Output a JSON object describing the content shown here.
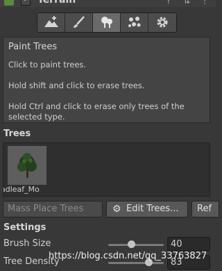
{
  "header": {
    "title": "Terrain"
  },
  "toolbar": {
    "tools": [
      {
        "name": "raise-lower-terrain",
        "active": false
      },
      {
        "name": "paint-texture",
        "active": false
      },
      {
        "name": "paint-trees",
        "active": true
      },
      {
        "name": "paint-details",
        "active": false
      },
      {
        "name": "terrain-settings",
        "active": false
      }
    ]
  },
  "help": {
    "title": "Paint Trees",
    "line1": "Click to paint trees.",
    "line2": "Hold shift and click to erase trees.",
    "line3": "Hold Ctrl and click to erase only trees of the",
    "line4": "selected type."
  },
  "trees": {
    "title": "Trees",
    "items": [
      {
        "label": "adleaf_Mo"
      }
    ]
  },
  "actions": {
    "mass_place": "Mass Place Trees",
    "edit_trees": "Edit Trees...",
    "refresh": "Ref"
  },
  "settings": {
    "title": "Settings",
    "brush_size_label": "Brush Size",
    "brush_size_value": "40",
    "tree_density_label": "Tree Density",
    "tree_density_value": "83"
  },
  "watermark": "https://blog.csdn.net/qq_33763827"
}
